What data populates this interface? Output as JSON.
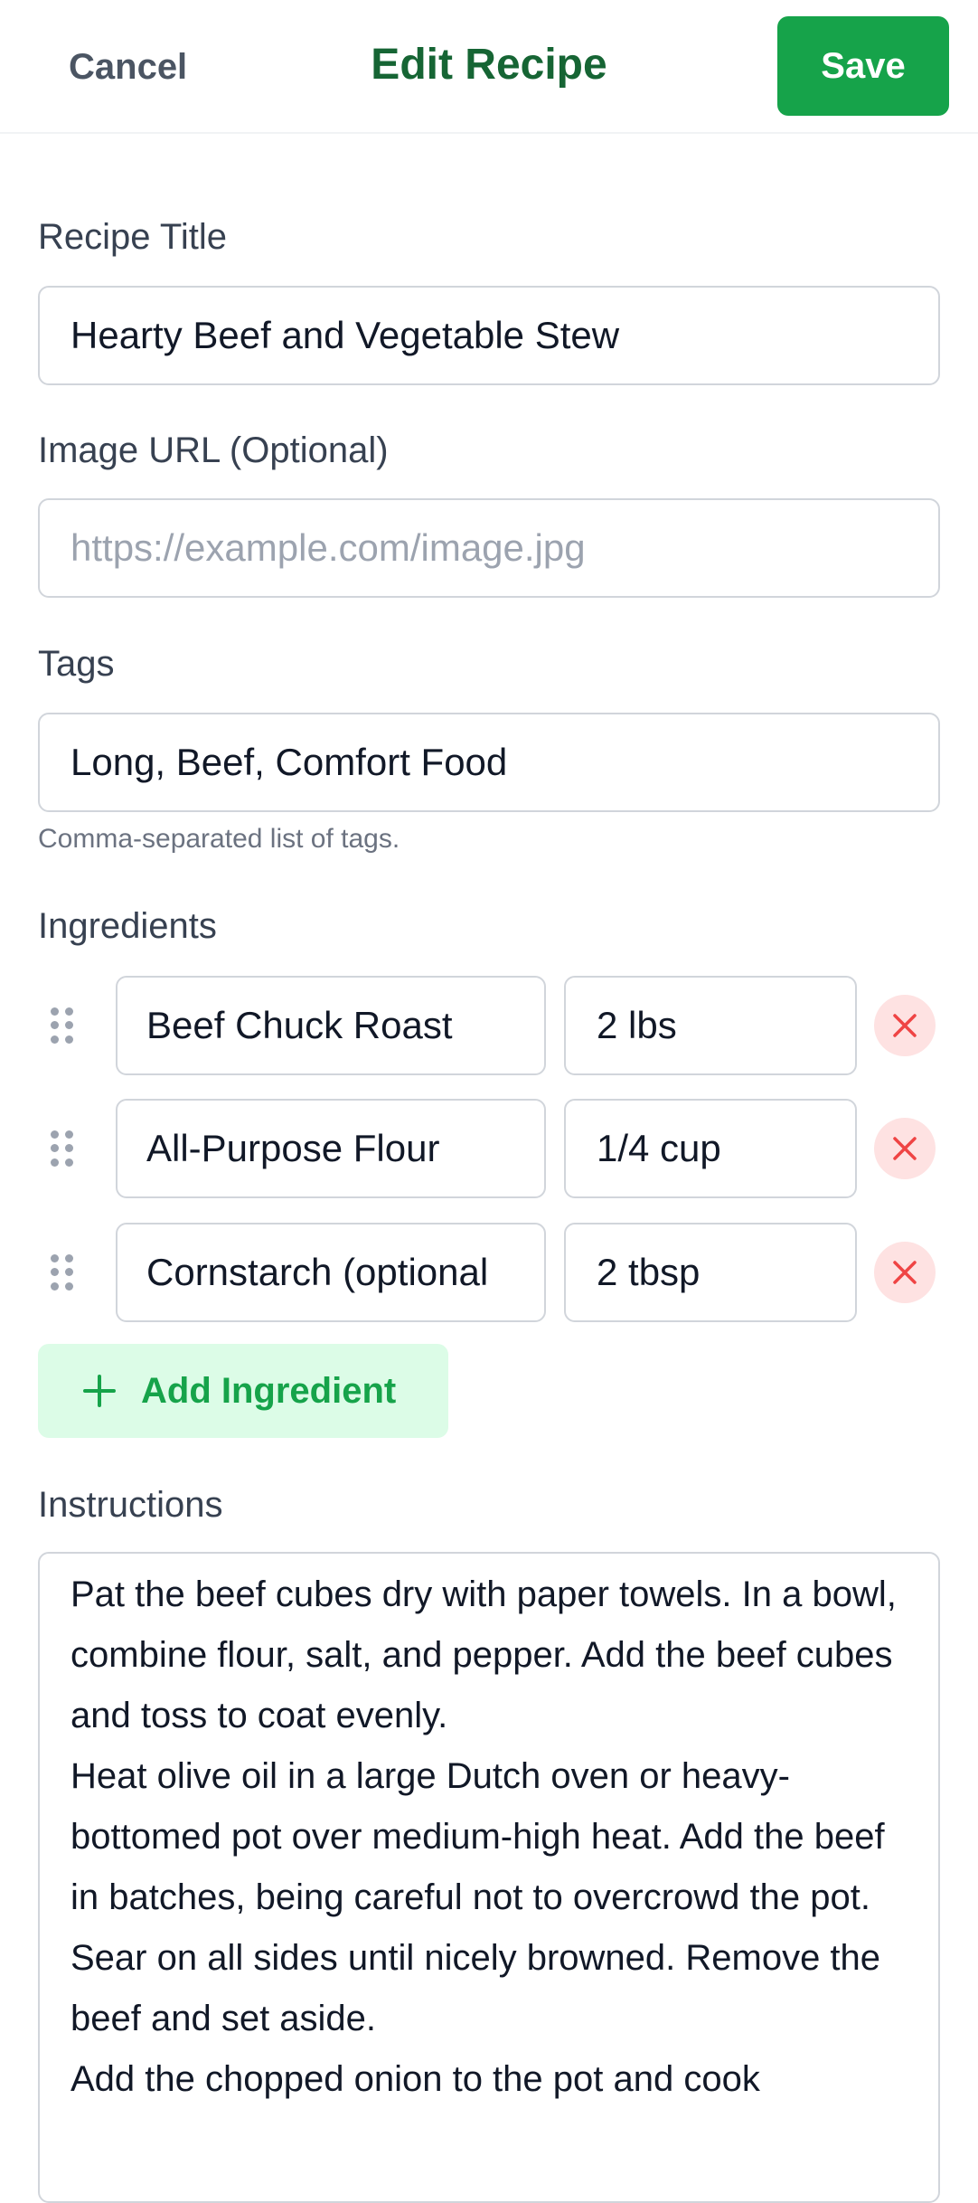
{
  "header": {
    "cancel_label": "Cancel",
    "title": "Edit Recipe",
    "save_label": "Save"
  },
  "form": {
    "title_label": "Recipe Title",
    "title_value": "Hearty Beef and Vegetable Stew",
    "image_label": "Image URL (Optional)",
    "image_placeholder": "https://example.com/image.jpg",
    "tags_label": "Tags",
    "tags_value": "Long, Beef, Comfort Food",
    "tags_help": "Comma-separated list of tags.",
    "ingredients_label": "Ingredients",
    "ingredients": [
      {
        "name": "Beef Chuck Roast",
        "qty": "2 lbs"
      },
      {
        "name": "All-Purpose Flour",
        "qty": "1/4 cup"
      },
      {
        "name": "Cornstarch (optional",
        "qty": "2 tbsp"
      }
    ],
    "add_ingredient_label": "Add Ingredient",
    "instructions_label": "Instructions",
    "instructions": [
      "Pat the beef cubes dry with paper towels. In a bowl, combine flour, salt, and pepper. Add the beef cubes and toss to coat evenly.",
      "Heat olive oil in a large Dutch oven or heavy-bottomed pot over medium-high heat. Add the beef in batches, being careful not to overcrowd the pot. Sear on all sides until nicely browned. Remove the beef and set aside.",
      "Add the chopped onion to the pot and cook"
    ]
  },
  "icons": {
    "drag": "drag-handle-icon",
    "remove": "close-icon",
    "add": "plus-icon"
  },
  "colors": {
    "accent": "#16a34a",
    "title": "#166534",
    "remove_bg": "#fee2e2",
    "remove_icon": "#ef4444",
    "add_bg": "#dcfce7"
  }
}
